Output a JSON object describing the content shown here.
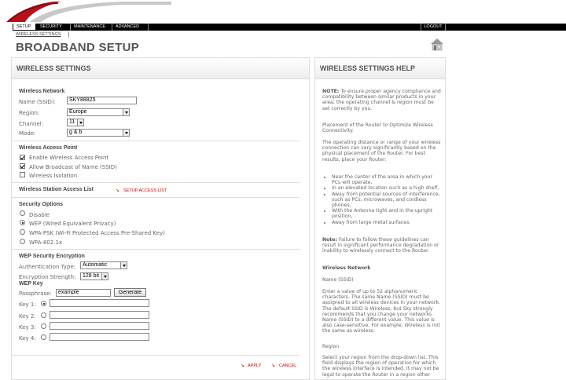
{
  "nav": {
    "tabs": [
      "SETUP",
      "SECURITY",
      "MAINTENANCE",
      "ADVANCED"
    ],
    "logout": "LOGOUT"
  },
  "breadcrumb": "WIRELESS SETTINGS",
  "breadcrumb_sep": "|",
  "page_title": "BROADBAND SETUP",
  "main": {
    "title": "WIRELESS SETTINGS",
    "network": {
      "heading": "Wireless Network",
      "ssid_label": "Name (SSID):",
      "ssid_value": "SKY88825",
      "region_label": "Region:",
      "region_value": "Europe",
      "channel_label": "Channel:",
      "channel_value": "11",
      "mode_label": "Mode:",
      "mode_value": "g & b"
    },
    "access_point": {
      "heading": "Wireless Access Point",
      "enable": "Enable Wireless Access Point",
      "broadcast": "Allow Broadcast of Name (SSID)",
      "isolation": "Wireless Isolation"
    },
    "station": {
      "heading": "Wireless Station Access List",
      "link": "SETUP ACCESS LIST"
    },
    "security": {
      "heading": "Security Options",
      "options": [
        "Disable",
        "WEP (Wired Equivalent Privacy)",
        "WPA-PSK (Wi-Fi Protected Access Pre-Shared Key)",
        "WPA-802.1x"
      ]
    },
    "wep": {
      "heading": "WEP Security Encryption",
      "auth_label": "Authentication Type:",
      "auth_value": "Automatic",
      "strength_label": "Encryption Strength:",
      "strength_value": "128 bit",
      "key_heading": "WEP Key",
      "passphrase_label": "Passphrase:",
      "passphrase_value": "example",
      "generate": "Generate",
      "keys": [
        "Key 1:",
        "Key 2:",
        "Key 3:",
        "Key 4:"
      ]
    },
    "apply": "APPLY",
    "cancel": "CANCEL"
  },
  "help": {
    "title": "WIRELESS SETTINGS HELP",
    "note_label": "NOTE:",
    "note": "To ensure proper agency compliance and compatibility between similar products in your area; the operating channel & region must be set correctly by you.",
    "placement": "Placement of the Router to Optimize Wireless Connectivity.",
    "distance": "The operating distance or range of your wireless connection can vary significantly based on the physical placement of the Router. For best results, place your Router:",
    "bullets": [
      "Near the center of the area in which your PCs will operate,",
      "In an elevated location such as a high shelf,",
      "Away from potential sources of interference, such as PCs, microwaves, and cordless phones,",
      "With the Antenna tight and in the upright position,",
      "Away from large metal surfaces."
    ],
    "note2_label": "Note:",
    "note2": "Failure to follow these guidelines can result in significant performance degradation or inability to wirelessly connect to the Router.",
    "wn_heading": "Wireless Network",
    "ssid_heading": "Name (SSID)",
    "ssid_text": "Enter a value of up to 32 alphanumeric characters. The same Name (SSID) must be assigned to all wireless devices in your network. The default SSID is Wireless, but Sky strongly recommends that you change your networks Name (SSID) to a different value. This value is also case-sensitive. For example,",
    "ssid_text_em": "Wireless",
    "ssid_text_end": "is not the same as wireless.",
    "region_heading": "Region",
    "region_text": "Select your region from the drop-down list. This field displays the region of operation for which the wireless interface is intended. It may not be legal to operate the Router in a region other"
  },
  "colors": {
    "accent": "#cc0000",
    "bar": "#000000"
  }
}
